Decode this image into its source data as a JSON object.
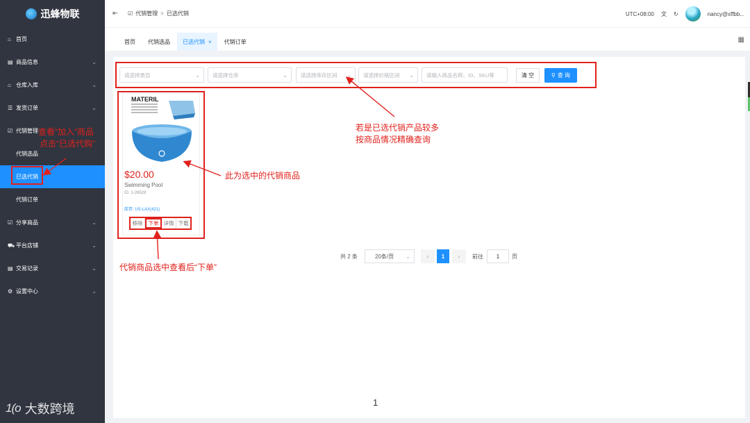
{
  "brand": {
    "name": "迅蜂物联"
  },
  "sidebar": {
    "items": [
      {
        "icon": "⌂",
        "label": "首页",
        "has_chevron": false
      },
      {
        "icon": "▤",
        "label": "商品信息",
        "has_chevron": true
      },
      {
        "icon": "⌂",
        "label": "仓库入库",
        "has_chevron": true
      },
      {
        "icon": "☰",
        "label": "发货订单",
        "has_chevron": true
      },
      {
        "icon": "☑",
        "label": "代销管理",
        "has_chevron": false
      },
      {
        "label": "代销选品",
        "sub": true
      },
      {
        "label": "已选代销",
        "sub": true,
        "active": true
      },
      {
        "label": "代销订单",
        "sub": true
      },
      {
        "icon": "☑",
        "label": "分享商品",
        "has_chevron": true
      },
      {
        "icon": "⛟",
        "label": "平台店铺",
        "has_chevron": true
      },
      {
        "icon": "▤",
        "label": "交易记录",
        "has_chevron": true
      },
      {
        "icon": "⚙",
        "label": "设置中心",
        "has_chevron": true
      }
    ]
  },
  "watermark": {
    "logo_text": "1(o",
    "label": "大数跨境"
  },
  "header": {
    "breadcrumb": [
      "代销管理",
      "已选代销"
    ],
    "timezone": "UTC+08:00",
    "user": "nancy@xffbb..."
  },
  "tabs": [
    {
      "label": "首页"
    },
    {
      "label": "代销选品"
    },
    {
      "label": "已选代销",
      "active": true,
      "closable": true
    },
    {
      "label": "代销订单"
    }
  ],
  "filters": {
    "category_placeholder": "请选择类目",
    "warehouse_placeholder": "请选择仓库",
    "stock_placeholder": "请选择库存区间",
    "price_placeholder": "请选择价格区间",
    "keyword_placeholder": "请输入商品名称、ID、SKU等",
    "clear_label": "清 空",
    "query_label": "查 询"
  },
  "product": {
    "image_caption": "MATERIL",
    "price": "$20.00",
    "name": "Swimming Pool",
    "id": "ID: 1-26528",
    "stock": "库存: US-LAX(421)",
    "actions": [
      "移除",
      "下单",
      "详情",
      "下载"
    ]
  },
  "pagination": {
    "total": "共 2 条",
    "page_size": "20条/页",
    "current_page": "1",
    "goto_label": "前往",
    "goto_value": "1",
    "page_unit": "页"
  },
  "annotations": {
    "sidebar_note_line1": "查看“加入”商品",
    "sidebar_note_line2": "点击“已选代购”",
    "filter_note_line1": "若是已选代销产品较多",
    "filter_note_line2": "按商品情况精确查询",
    "card_note": "此为选中的代销商品",
    "order_note": "代销商品选中查看后“下单”"
  },
  "footer_page_number": "1",
  "colors": {
    "accent": "#1e90ff",
    "annotation": "#e0211c",
    "sidebar_bg": "#30353f"
  }
}
